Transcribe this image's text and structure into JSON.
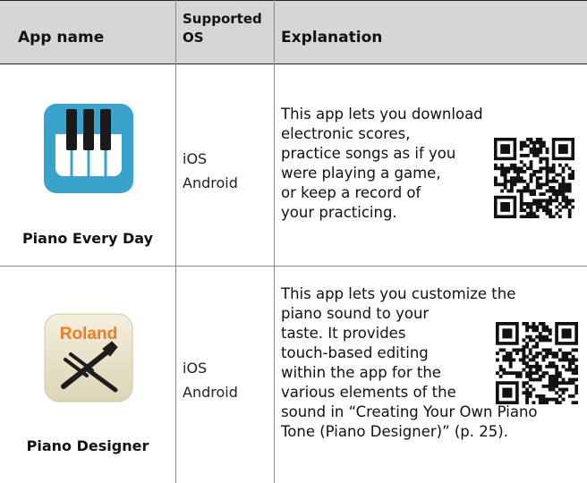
{
  "headers": {
    "app_name": "App name",
    "supported_os": "Supported OS",
    "explanation": "Explanation"
  },
  "rows": [
    {
      "app_name": "Piano Every Day",
      "icon": "piano-keys-icon",
      "os": [
        "iOS",
        "Android"
      ],
      "explanation_lines": [
        "This app lets you download",
        "electronic scores,",
        "practice songs as if you",
        "were playing a game,",
        "or keep a record of",
        "your practicing."
      ]
    },
    {
      "app_name": "Piano Designer",
      "icon": "tuning-fork-wrench-icon",
      "icon_text": "Roland",
      "os": [
        "iOS",
        "Android"
      ],
      "explanation_lines": [
        "This app lets you customize the",
        "piano sound to your",
        "taste. It provides",
        "touch-based editing",
        "within the app for the",
        "various elements of the",
        "sound in “Creating Your Own Piano",
        "Tone (Piano Designer)” (p. 25)."
      ]
    }
  ],
  "colors": {
    "header_bg": "#d6d6d6",
    "piano_icon_bg": "#3aa3cc",
    "designer_icon_bg": "#ece6cf",
    "roland_orange": "#ee7d22"
  }
}
